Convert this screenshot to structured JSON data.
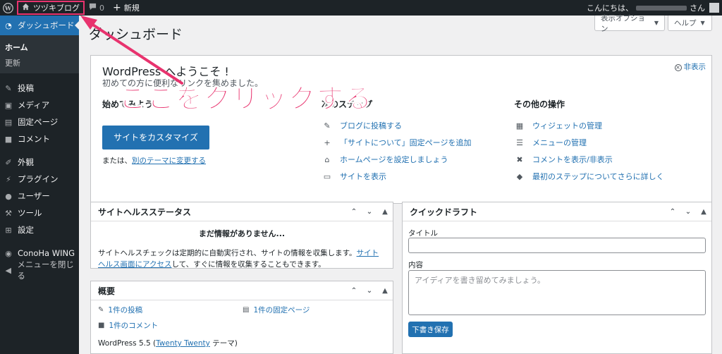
{
  "admin_bar": {
    "site_name": "ツヅキブログ",
    "comments_count": "0",
    "new_label": "新規",
    "greeting": "こんにちは、",
    "greeting_suffix": "さん"
  },
  "sidebar": {
    "dashboard": "ダッシュボード",
    "sub": [
      "ホーム",
      "更新"
    ],
    "items": [
      "投稿",
      "メディア",
      "固定ページ",
      "コメント"
    ],
    "items2": [
      "外観",
      "プラグイン",
      "ユーザー",
      "ツール",
      "設定"
    ],
    "items3": [
      "ConoHa WING",
      "メニューを閉じる"
    ]
  },
  "header": {
    "title": "ダッシュボード",
    "screen_options": "表示オプション",
    "help": "ヘルプ"
  },
  "welcome": {
    "title": "WordPress へようこそ !",
    "about": "初めての方に便利なリンクを集めました。",
    "dismiss": "非表示",
    "col1_title": "始めてみよう",
    "customize_button": "サイトをカスタマイズ",
    "or_prefix": "または、",
    "or_link": "別のテーマに変更する",
    "col2_title": "次のステップ",
    "next_steps": [
      "ブログに投稿する",
      "「サイトについて」固定ページを追加",
      "ホームページを設定しましょう",
      "サイトを表示"
    ],
    "col3_title": "その他の操作",
    "more_actions": [
      "ウィジェットの管理",
      "メニューの管理",
      "コメントを表示/非表示",
      "最初のステップについてさらに詳しく"
    ],
    "annotation": "ここをクリックする"
  },
  "site_health": {
    "title": "サイトヘルスステータス",
    "no_info": "まだ情報がありません...",
    "text_before": "サイトヘルスチェックは定期的に自動実行され、サイトの情報を収集します。",
    "link": "サイトヘルス画面にアクセス",
    "text_after": "して、すぐに情報を収集することもできます。"
  },
  "overview": {
    "title": "概要",
    "posts": "1件の投稿",
    "pages": "1件の固定ページ",
    "comments": "1件のコメント",
    "version_prefix": "WordPress 5.5 (",
    "theme": "Twenty Twenty",
    "version_suffix": " テーマ)"
  },
  "quick_draft": {
    "title": "クイックドラフト",
    "title_label": "タイトル",
    "content_label": "内容",
    "content_placeholder": "アイディアを書き留めてみましょう。",
    "save_button": "下書き保存"
  },
  "colors": {
    "accent": "#2271b1",
    "annotation": "#e8336e",
    "admin_bg": "#1d2327"
  }
}
